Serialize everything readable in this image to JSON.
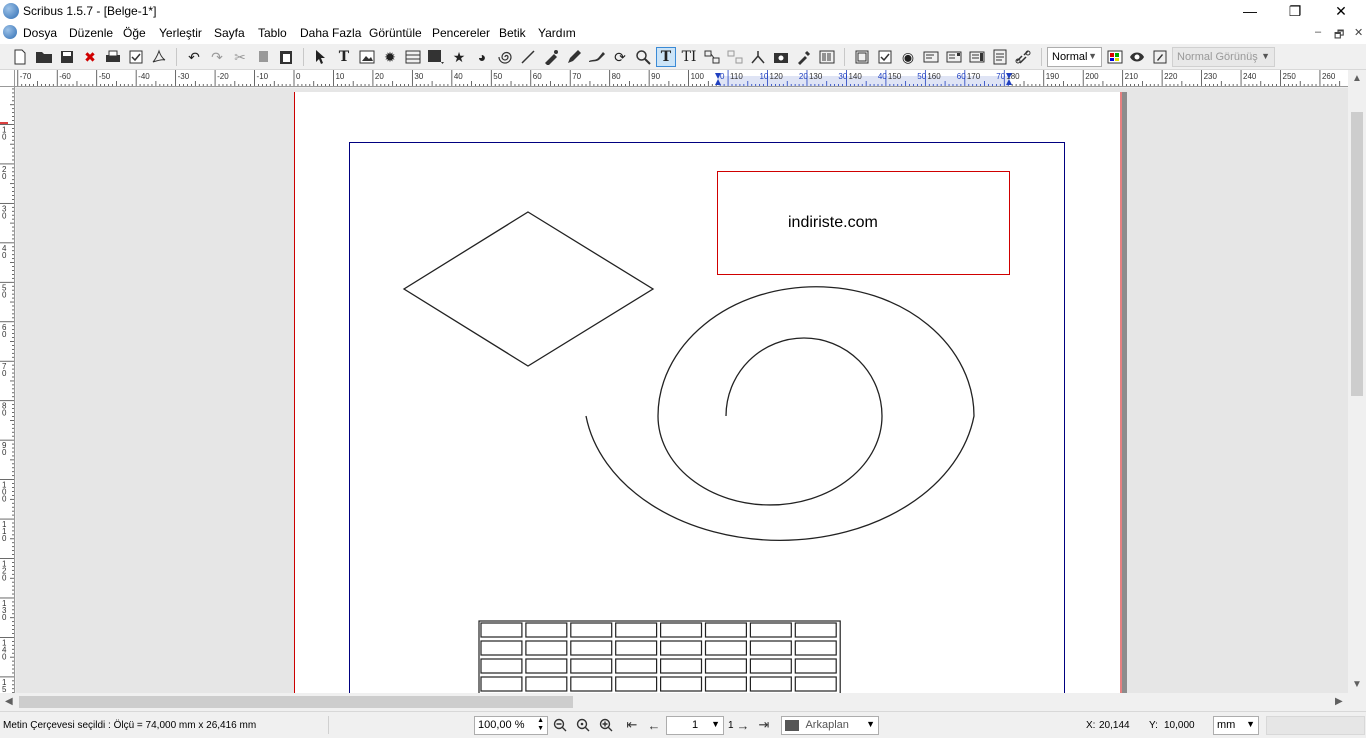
{
  "window": {
    "title": "Scribus 1.5.7 - [Belge-1*]",
    "minimize": "—",
    "maximize": "❐",
    "close": "✕"
  },
  "menu": {
    "items": [
      "Dosya",
      "Düzenle",
      "Öğe",
      "Yerleştir",
      "Sayfa",
      "Tablo",
      "Daha Fazla",
      "Görüntüle",
      "Pencereler",
      "Betik",
      "Yardım"
    ],
    "mdi_minimize": "–",
    "mdi_restore": "🗗",
    "mdi_close": "✕"
  },
  "toolbar": {
    "view_mode": "Normal",
    "preview_mode": "Normal Görünüş"
  },
  "ruler": {
    "h_labels": [
      "-70",
      "-60",
      "-50",
      "-40",
      "-30",
      "-20",
      "-10",
      "0",
      "10",
      "20",
      "30",
      "40",
      "50",
      "60",
      "70",
      "80",
      "90",
      "100",
      "110",
      "120",
      "130",
      "140",
      "150",
      "160",
      "170",
      "180",
      "190",
      "200",
      "210",
      "220",
      "230",
      "240",
      "250",
      "260"
    ],
    "h_frame_labels": [
      "0",
      "10",
      "20",
      "30",
      "40",
      "50",
      "60",
      "70"
    ],
    "v_labels": [
      "1\n0",
      "2\n0",
      "3\n0",
      "4\n0",
      "5\n0",
      "6\n0",
      "7\n0",
      "8\n0",
      "9\n0",
      "1\n0\n0",
      "1\n1\n0",
      "1\n2\n0",
      "1\n3\n0",
      "1\n4\n0",
      "1\n5"
    ]
  },
  "canvas": {
    "text_frame_content": "indiriste.com",
    "table_rows": 4,
    "table_cols": 8
  },
  "status": {
    "message": "Metin Çerçevesi seçildi : Ölçü = 74,000 mm x 26,416 mm",
    "zoom": "100,00 %",
    "page_number": "1",
    "page_total": "1",
    "layer": "Arkaplan",
    "x_label": "X:",
    "x_value": "20,144",
    "y_label": "Y:",
    "y_value": "10,000",
    "unit": "mm"
  },
  "colors": {
    "selection_red": "#d00000",
    "margin_blue": "#000080",
    "bleed_red": "#cc0000"
  }
}
